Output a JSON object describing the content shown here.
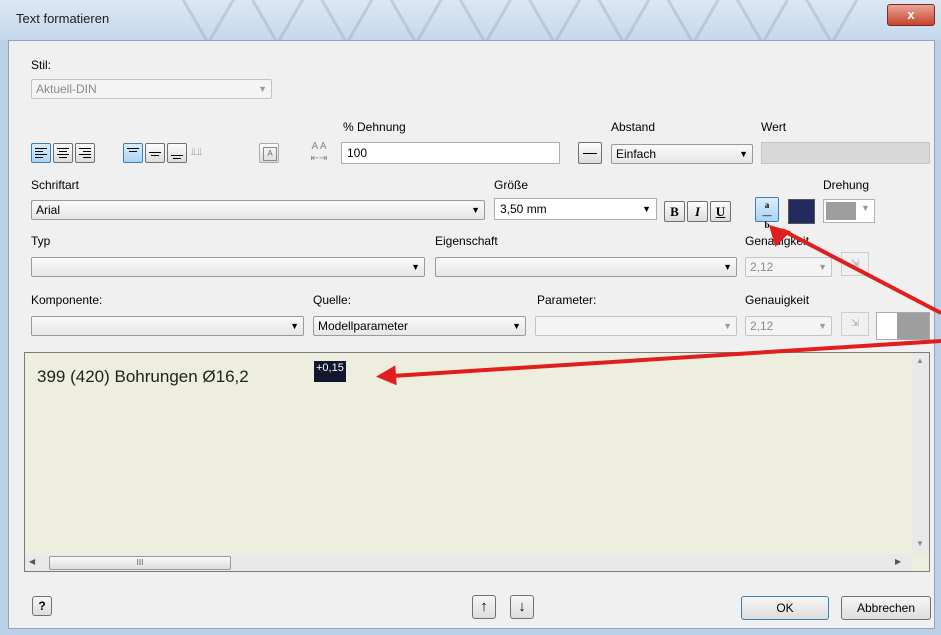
{
  "window": {
    "title": "Text formatieren",
    "close_label": "x"
  },
  "style": {
    "label": "Stil:",
    "value": "Aktuell-DIN"
  },
  "stretch": {
    "label": "% Dehnung",
    "value": "100"
  },
  "spacing": {
    "label": "Abstand",
    "value": "Einfach"
  },
  "spacing_value": {
    "label": "Wert",
    "value": ""
  },
  "font": {
    "label": "Schriftart",
    "value": "Arial"
  },
  "size": {
    "label": "Größe",
    "value": "3,50 mm"
  },
  "format_buttons": {
    "bold": "B",
    "italic": "I",
    "underline": "U"
  },
  "rotation": {
    "label": "Drehung"
  },
  "colors": {
    "text": "#232a5e",
    "rotation_swatch": "#9e9e9e"
  },
  "type": {
    "label": "Typ",
    "value": ""
  },
  "property": {
    "label": "Eigenschaft",
    "value": ""
  },
  "precision1": {
    "label": "Genauigkeit",
    "value": "2,12"
  },
  "component": {
    "label": "Komponente:",
    "value": ""
  },
  "source": {
    "label": "Quelle:",
    "value": "Modellparameter"
  },
  "parameter": {
    "label": "Parameter:",
    "value": ""
  },
  "precision2": {
    "label": "Genauigkeit",
    "value": "2,12"
  },
  "editor": {
    "text": "399 (420) Bohrungen Ø16,2",
    "tolerance_upper": "+0,15"
  },
  "scroll": {
    "thumb_glyph": "III"
  },
  "buttons": {
    "help": "?",
    "up": "↑",
    "down": "↓",
    "ok": "OK",
    "cancel": "Abbrechen"
  },
  "annotation_color": "#e01e1e"
}
